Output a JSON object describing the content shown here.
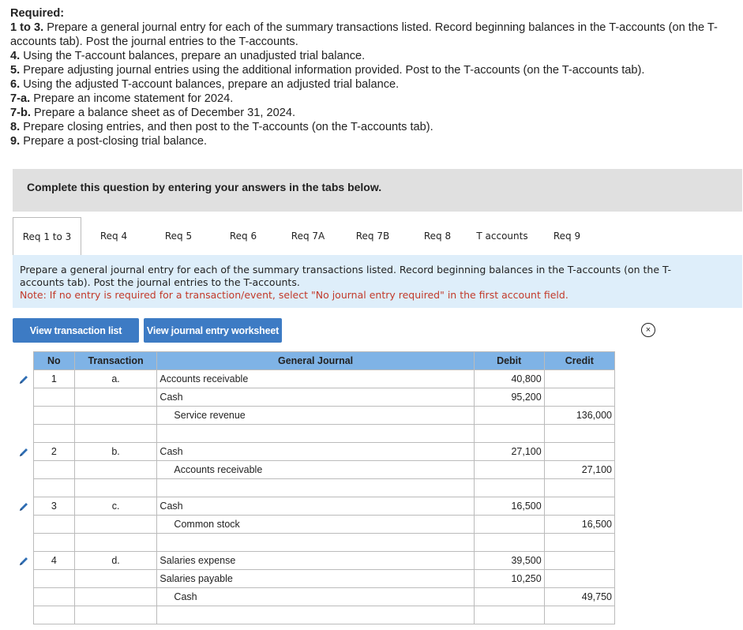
{
  "required": {
    "heading": "Required:",
    "items": [
      {
        "label": "1 to 3.",
        "text": " Prepare a general journal entry for each of the summary transactions listed. Record beginning balances in the T-accounts (on the T-accounts tab). Post the journal entries to the T-accounts."
      },
      {
        "label": "4.",
        "text": " Using the T-account balances, prepare an unadjusted trial balance."
      },
      {
        "label": "5.",
        "text": " Prepare adjusting journal entries using the additional information provided. Post to the T-accounts (on the T-accounts tab)."
      },
      {
        "label": "6.",
        "text": " Using the adjusted T-account balances, prepare an adjusted trial balance."
      },
      {
        "label": "7-a.",
        "text": " Prepare an income statement for 2024."
      },
      {
        "label": "7-b.",
        "text": " Prepare a balance sheet as of December 31, 2024."
      },
      {
        "label": "8.",
        "text": " Prepare closing entries, and then post to the T-accounts (on the T-accounts tab)."
      },
      {
        "label": "9.",
        "text": " Prepare a post-closing trial balance."
      }
    ]
  },
  "banner": "Complete this question by entering your answers in the tabs below.",
  "tabs": [
    "Req 1 to 3",
    "Req 4",
    "Req 5",
    "Req 6",
    "Req 7A",
    "Req 7B",
    "Req 8",
    "T accounts",
    "Req 9"
  ],
  "instructions": {
    "text": "Prepare a general journal entry for each of the summary transactions listed. Record beginning balances in the T-accounts (on the T-accounts tab). Post the journal entries to the T-accounts.",
    "note": "Note: If no entry is required for a transaction/event, select \"No journal entry required\" in the first account field."
  },
  "buttons": {
    "view_transactions": "View transaction list",
    "view_worksheet": "View journal entry worksheet",
    "close_symbol": "×"
  },
  "table": {
    "headers": {
      "no": "No",
      "transaction": "Transaction",
      "journal": "General Journal",
      "debit": "Debit",
      "credit": "Credit"
    },
    "rows": [
      {
        "no": "1",
        "tr": "a.",
        "account": "Accounts receivable",
        "indent": false,
        "debit": "40,800",
        "credit": ""
      },
      {
        "no": "",
        "tr": "",
        "account": "Cash",
        "indent": false,
        "debit": "95,200",
        "credit": ""
      },
      {
        "no": "",
        "tr": "",
        "account": "Service revenue",
        "indent": true,
        "debit": "",
        "credit": "136,000"
      },
      {
        "no": "",
        "tr": "",
        "account": "",
        "indent": false,
        "debit": "",
        "credit": ""
      },
      {
        "no": "2",
        "tr": "b.",
        "account": "Cash",
        "indent": false,
        "debit": "27,100",
        "credit": ""
      },
      {
        "no": "",
        "tr": "",
        "account": "Accounts receivable",
        "indent": true,
        "debit": "",
        "credit": "27,100"
      },
      {
        "no": "",
        "tr": "",
        "account": "",
        "indent": false,
        "debit": "",
        "credit": ""
      },
      {
        "no": "3",
        "tr": "c.",
        "account": "Cash",
        "indent": false,
        "debit": "16,500",
        "credit": ""
      },
      {
        "no": "",
        "tr": "",
        "account": "Common stock",
        "indent": true,
        "debit": "",
        "credit": "16,500"
      },
      {
        "no": "",
        "tr": "",
        "account": "",
        "indent": false,
        "debit": "",
        "credit": ""
      },
      {
        "no": "4",
        "tr": "d.",
        "account": "Salaries expense",
        "indent": false,
        "debit": "39,500",
        "credit": ""
      },
      {
        "no": "",
        "tr": "",
        "account": "Salaries payable",
        "indent": false,
        "debit": "10,250",
        "credit": ""
      },
      {
        "no": "",
        "tr": "",
        "account": "Cash",
        "indent": true,
        "debit": "",
        "credit": "49,750"
      },
      {
        "no": "",
        "tr": "",
        "account": "",
        "indent": false,
        "debit": "",
        "credit": ""
      }
    ]
  },
  "colors": {
    "accent": "#3d7bc4",
    "header": "#7fb3e6",
    "note": "#c23a2a",
    "instr_bg": "#deeefa"
  },
  "icons": {
    "edit": "pencil-icon",
    "close": "close-circle-icon"
  }
}
